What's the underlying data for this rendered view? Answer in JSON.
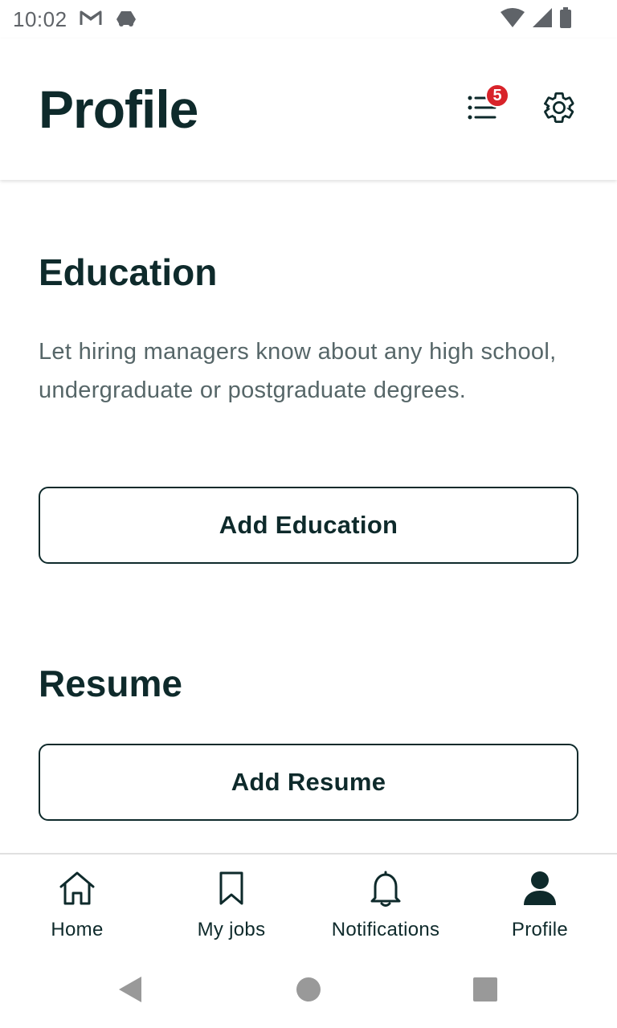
{
  "status_bar": {
    "time": "10:02",
    "icons": [
      "gmail-icon",
      "drive-icon",
      "wifi-icon",
      "signal-icon",
      "battery-icon"
    ]
  },
  "header": {
    "title": "Profile",
    "list_icon": "checklist-icon",
    "badge_count": "5",
    "settings_icon": "gear-icon"
  },
  "education": {
    "title": "Education",
    "description": "Let hiring managers know about any high school, undergraduate or postgraduate degrees.",
    "button_label": "Add Education"
  },
  "resume": {
    "title": "Resume",
    "button_label": "Add Resume"
  },
  "bottom_nav": {
    "items": [
      {
        "label": "Home",
        "icon": "home-icon"
      },
      {
        "label": "My jobs",
        "icon": "bookmark-icon"
      },
      {
        "label": "Notifications",
        "icon": "bell-icon"
      },
      {
        "label": "Profile",
        "icon": "person-icon",
        "active": true
      }
    ]
  },
  "system_nav": {
    "buttons": [
      "back-icon",
      "home-circle-icon",
      "recents-icon"
    ]
  },
  "colors": {
    "primary_text": "#0e2a2b",
    "secondary_text": "#566668",
    "badge": "#d8232a",
    "status_gray": "#5f6368"
  }
}
